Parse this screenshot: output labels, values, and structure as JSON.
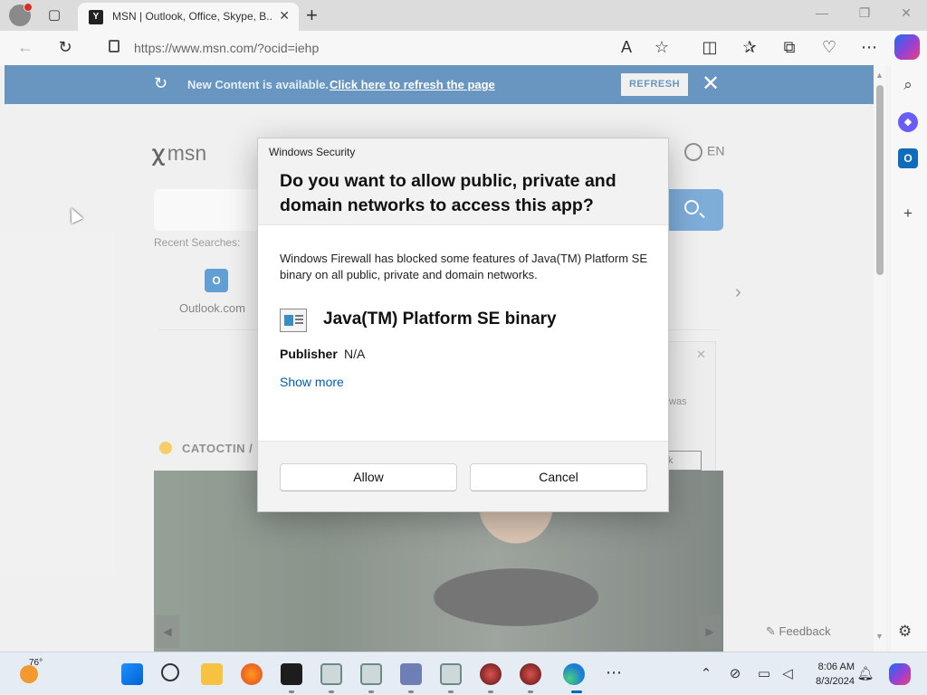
{
  "browser": {
    "tab_title": "MSN | Outlook, Office, Skype, B...",
    "url": "https://www.msn.com/?ocid=iehp"
  },
  "banner": {
    "text": "New Content is available.",
    "link": "Click here to refresh the page",
    "button": "REFRESH"
  },
  "msn": {
    "logo_text": "msn",
    "language": "EN",
    "recent_searches_label": "Recent Searches:",
    "quick_link": "Outlook.com",
    "weather_location": "CATOCTIN /",
    "feedback_label": "Feedback"
  },
  "background_dialog": {
    "text_fragment": "was",
    "button_fragment": "k"
  },
  "dialog": {
    "caption": "Windows Security",
    "title": "Do you want to allow public, private and domain networks to access this app?",
    "body": "Windows Firewall has blocked some features of Java(TM) Platform SE binary on all public, private and domain networks.",
    "app_name": "Java(TM) Platform SE binary",
    "publisher_label": "Publisher",
    "publisher_value": "N/A",
    "show_more": "Show more",
    "allow_button": "Allow",
    "cancel_button": "Cancel"
  },
  "taskbar": {
    "weather_temp": "76°",
    "time": "8:06 AM",
    "date": "8/3/2024"
  },
  "colors": {
    "banner_bg": "#185ea0",
    "search_button": "#3a82c7",
    "link": "#005fb8",
    "taskbar_bg": "#e6ecf3"
  }
}
